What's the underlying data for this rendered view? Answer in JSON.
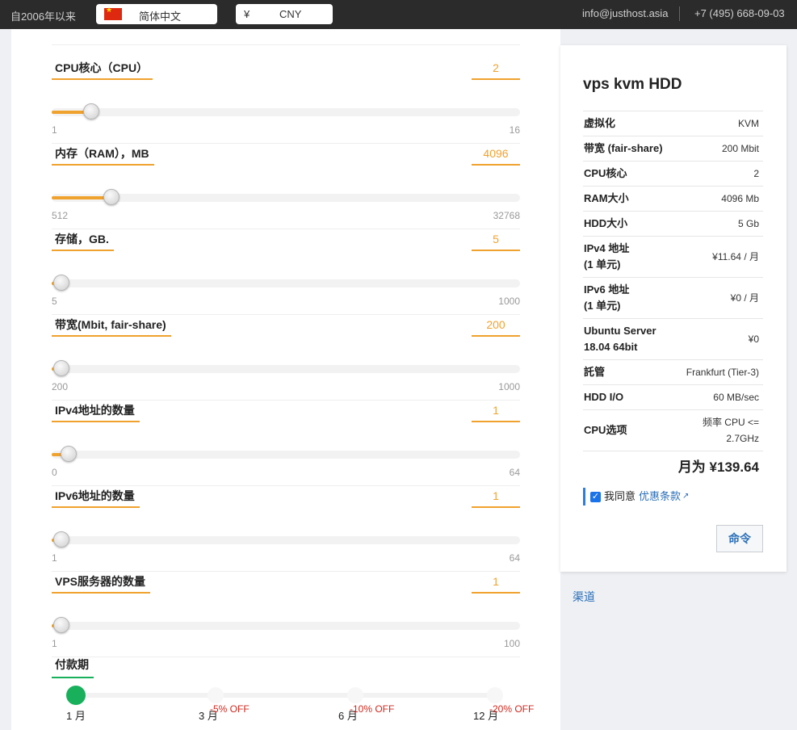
{
  "topbar": {
    "since": "自2006年以来",
    "language": "简体中文",
    "currency_symbol": "¥",
    "currency": "CNY",
    "email": "info@justhost.asia",
    "phone": "+7 (495) 668-09-03"
  },
  "sliders": [
    {
      "label": "CPU核心（CPU）",
      "value": "2",
      "min": "1",
      "max": "16",
      "fraction": 0.067
    },
    {
      "label": "内存（RAM），MB",
      "value": "4096",
      "min": "512",
      "max": "32768",
      "fraction": 0.111
    },
    {
      "label": "存储，GB.",
      "value": "5",
      "min": "5",
      "max": "1000",
      "fraction": 0
    },
    {
      "label": "带宽(Mbit, fair-share)",
      "value": "200",
      "min": "200",
      "max": "1000",
      "fraction": 0
    },
    {
      "label": "IPv4地址的数量",
      "value": "1",
      "min": "0",
      "max": "64",
      "fraction": 0.016
    },
    {
      "label": "IPv6地址的数量",
      "value": "1",
      "min": "1",
      "max": "64",
      "fraction": 0
    },
    {
      "label": "VPS服务器的数量",
      "value": "1",
      "min": "1",
      "max": "100",
      "fraction": 0
    }
  ],
  "period": {
    "title": "付款期",
    "options": [
      {
        "label": "1 月",
        "discount": ""
      },
      {
        "label": "3 月",
        "discount": "-5% OFF"
      },
      {
        "label": "6 月",
        "discount": "-10% OFF"
      },
      {
        "label": "12 月",
        "discount": "-20% OFF"
      }
    ],
    "selected": 0
  },
  "summary": {
    "title": "vps kvm HDD",
    "specs": [
      {
        "k": "虚拟化",
        "v": "KVM"
      },
      {
        "k": "带宽 (fair-share)",
        "v": "200 Mbit"
      },
      {
        "k": "CPU核心",
        "v": "2"
      },
      {
        "k": "RAM大小",
        "v": "4096 Mb"
      },
      {
        "k": "HDD大小",
        "v": "5 Gb"
      },
      {
        "k": "IPv4 地址\n(1 单元)",
        "v": "¥11.64 / 月"
      },
      {
        "k": "IPv6 地址\n(1 单元)",
        "v": "¥0 / 月"
      },
      {
        "k": "Ubuntu Server\n18.04 64bit",
        "v": "¥0"
      },
      {
        "k": "託管",
        "v": "Frankfurt (Tier-3)"
      },
      {
        "k": "HDD I/O",
        "v": "60 MB/sec"
      },
      {
        "k": "CPU选项",
        "v": "频率 CPU <=\n2.7GHz"
      }
    ],
    "total": "月为 ¥139.64",
    "agree_text": "我同意",
    "agree_link": "优惠条款",
    "agree_checked": true,
    "order_button": "命令"
  },
  "channel_link": "渠道"
}
